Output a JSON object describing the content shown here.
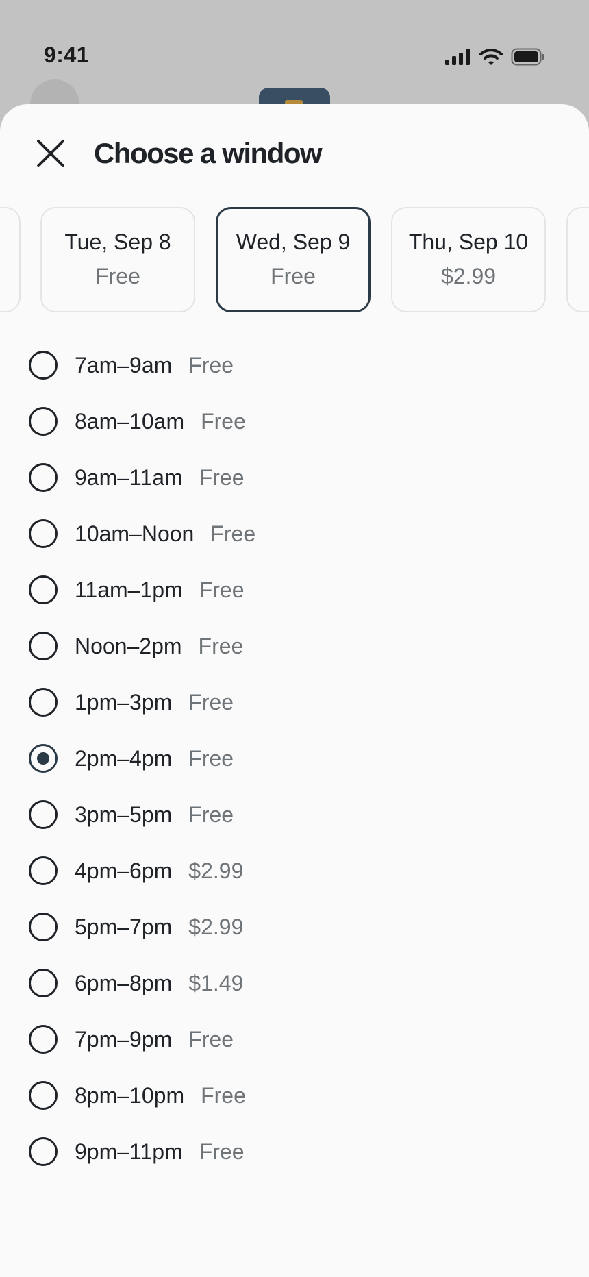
{
  "status_bar": {
    "time": "9:41",
    "icons": [
      "signal-icon",
      "wifi-icon",
      "battery-icon"
    ]
  },
  "sheet": {
    "title": "Choose a window",
    "close_icon": "close-icon"
  },
  "days": [
    {
      "date": "",
      "price": "",
      "selected": false
    },
    {
      "date": "Tue, Sep 8",
      "price": "Free",
      "selected": false
    },
    {
      "date": "Wed, Sep 9",
      "price": "Free",
      "selected": true
    },
    {
      "date": "Thu, Sep 10",
      "price": "$2.99",
      "selected": false
    },
    {
      "date": "",
      "price": "",
      "selected": false
    }
  ],
  "slots": [
    {
      "time": "7am–9am",
      "price": "Free",
      "selected": false
    },
    {
      "time": "8am–10am",
      "price": "Free",
      "selected": false
    },
    {
      "time": "9am–11am",
      "price": "Free",
      "selected": false
    },
    {
      "time": "10am–Noon",
      "price": "Free",
      "selected": false
    },
    {
      "time": "11am–1pm",
      "price": "Free",
      "selected": false
    },
    {
      "time": "Noon–2pm",
      "price": "Free",
      "selected": false
    },
    {
      "time": "1pm–3pm",
      "price": "Free",
      "selected": false
    },
    {
      "time": "2pm–4pm",
      "price": "Free",
      "selected": true
    },
    {
      "time": "3pm–5pm",
      "price": "Free",
      "selected": false
    },
    {
      "time": "4pm–6pm",
      "price": "$2.99",
      "selected": false
    },
    {
      "time": "5pm–7pm",
      "price": "$2.99",
      "selected": false
    },
    {
      "time": "6pm–8pm",
      "price": "$1.49",
      "selected": false
    },
    {
      "time": "7pm–9pm",
      "price": "Free",
      "selected": false
    },
    {
      "time": "8pm–10pm",
      "price": "Free",
      "selected": false
    },
    {
      "time": "9pm–11pm",
      "price": "Free",
      "selected": false
    }
  ],
  "colors": {
    "accent": "#2b3a47",
    "text": "#1f2328",
    "muted": "#6f7478",
    "border": "#e2e4e6"
  }
}
